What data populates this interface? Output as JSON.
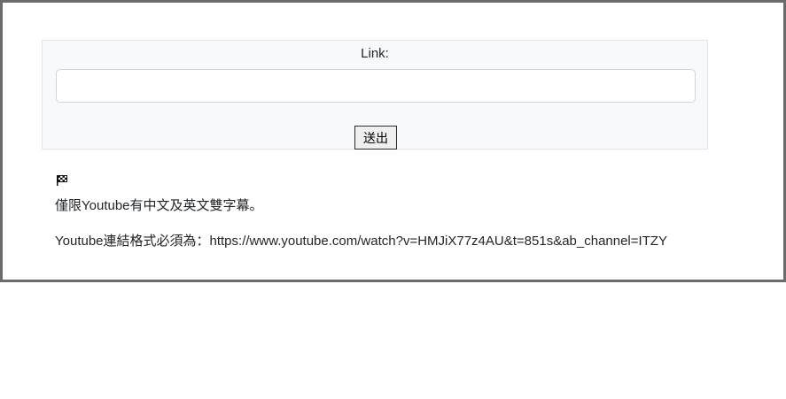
{
  "form": {
    "link_label": "Link:",
    "link_value": "",
    "link_placeholder": "",
    "submit_label": "送出"
  },
  "notes": {
    "flag_icon": "checkered-flag-icon",
    "supported_subtitles": "僅限Youtube有中文及英文雙字幕。",
    "format_rule": "Youtube連結格式必須為：https://www.youtube.com/watch?v=HMJiX77z4AU&t=851s&ab_channel=ITZY"
  }
}
